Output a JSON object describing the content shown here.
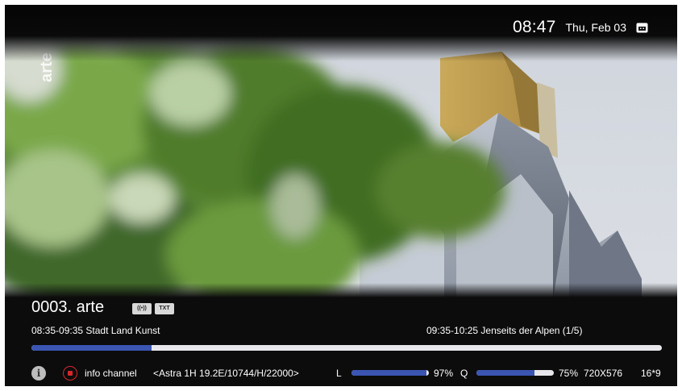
{
  "clock": {
    "time": "08:47",
    "date": "Thu, Feb 03"
  },
  "channel": {
    "title": "0003. arte",
    "badges": [
      "((•))",
      "TXT"
    ],
    "logo_text": "arte"
  },
  "events": {
    "now": "08:35-09:35 Stadt Land Kunst",
    "next": "09:35-10:25 Jenseits der Alpen (1/5)",
    "progress_fraction": 0.19
  },
  "info_bar": {
    "info_label": "info channel",
    "transponder": "<Astra 1H 19.2E/10744/H/22000>",
    "level_label": "L",
    "level_value": "97%",
    "level_fraction": 0.97,
    "quality_label": "Q",
    "quality_value": "75%",
    "quality_fraction": 0.75,
    "resolution": "720X576",
    "aspect": "16*9"
  },
  "colors": {
    "accent": "#3b55b2",
    "record": "#d9262b",
    "bar_track": "#e8e8ec"
  },
  "icons": {
    "calendar": "calendar-icon",
    "info": "info-icon",
    "record": "record-icon"
  }
}
